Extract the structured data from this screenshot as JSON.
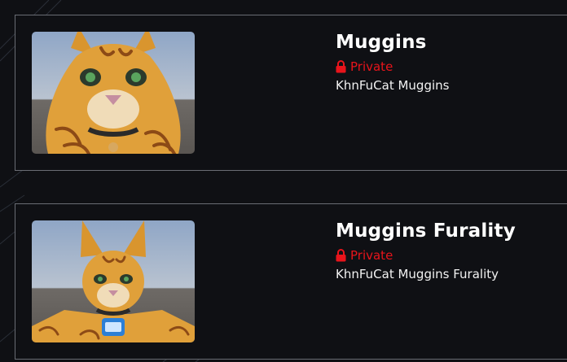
{
  "avatars": [
    {
      "name": "Muggins",
      "status": "Private",
      "description": "KhnFuCat Muggins",
      "thumbnail": "orange-cat-avatar-closeup"
    },
    {
      "name": "Muggins Furality",
      "status": "Private",
      "description": "KhnFuCat Muggins Furality",
      "thumbnail": "orange-cat-avatar-fullbody"
    }
  ],
  "colors": {
    "background": "#0f1014",
    "border": "#6a6d74",
    "private_red": "#e8141b",
    "title": "#ffffff"
  }
}
